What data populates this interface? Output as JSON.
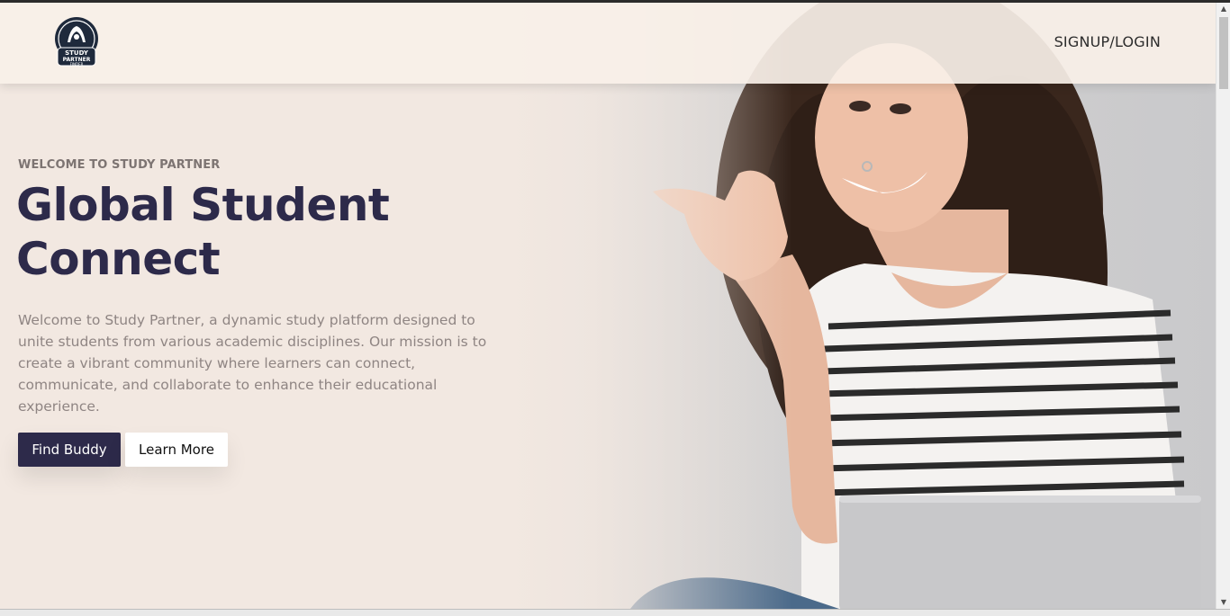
{
  "header": {
    "logo_text_lines": [
      "STUDY",
      "PARTNER",
      "FINDER"
    ],
    "nav_login_label": "SIGNUP/LOGIN"
  },
  "hero": {
    "eyebrow": "WELCOME TO STUDY PARTNER",
    "title": "Global Student Connect",
    "description": "Welcome to Study Partner, a dynamic study platform designed to unite students from various academic disciplines. Our mission is to create a vibrant community where learners can connect, communicate, and collaborate to enhance their educational experience.",
    "primary_button": "Find Buddy",
    "secondary_button": "Learn More"
  },
  "colors": {
    "background": "#f2e8e1",
    "header": "#f8f0e8",
    "brand_dark": "#2d2a4a",
    "muted_text": "#8f8583"
  },
  "icons": {
    "logo": "study-partner-finder-logo",
    "scroll_up": "triangle-up-icon",
    "scroll_down": "triangle-down-icon"
  }
}
